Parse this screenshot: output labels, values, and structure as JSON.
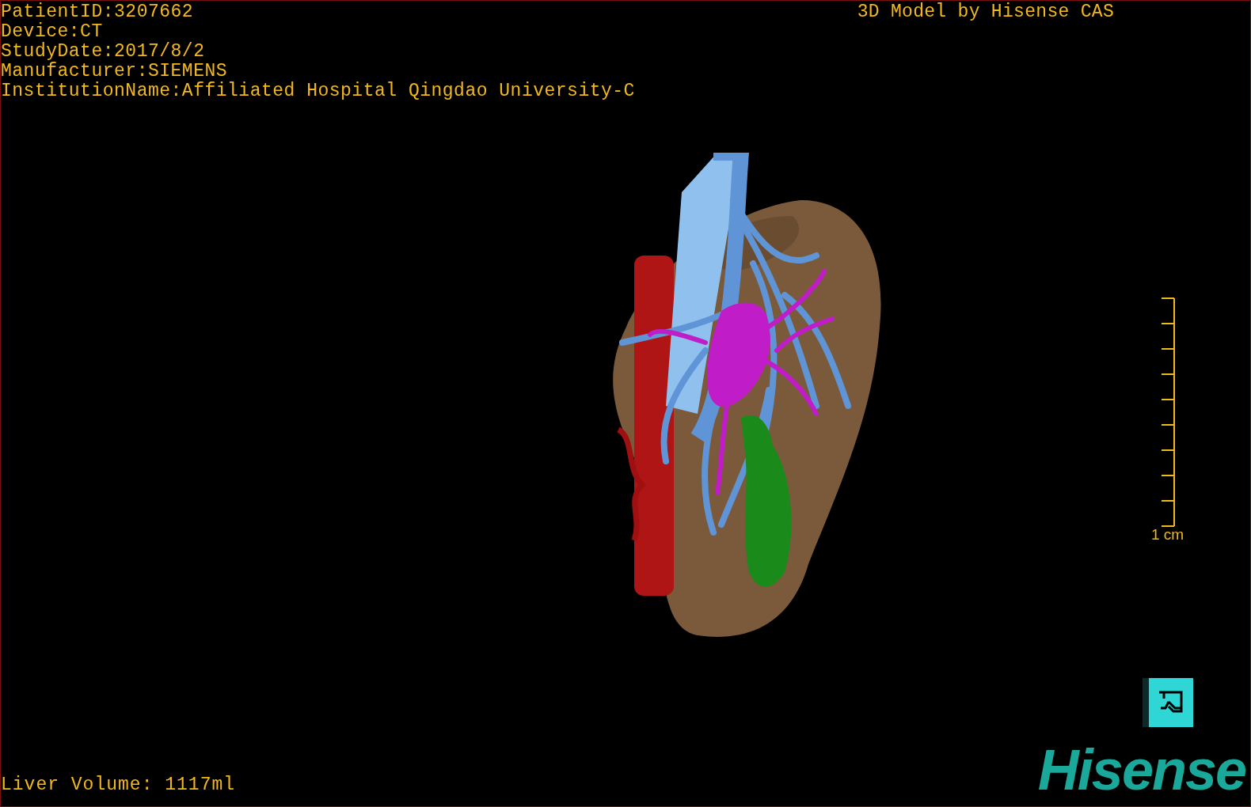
{
  "patient_info": [
    "PatientID:3207662",
    "Device:CT",
    "StudyDate:2017/8/2",
    "Manufacturer:SIEMENS",
    "InstitutionName:Affiliated Hospital Qingdao University-C"
  ],
  "title": "3D Model by Hisense CAS",
  "scale_bar": {
    "label": "1 cm"
  },
  "liver_volume": "Liver Volume: 1117ml",
  "logo": "Hisense"
}
